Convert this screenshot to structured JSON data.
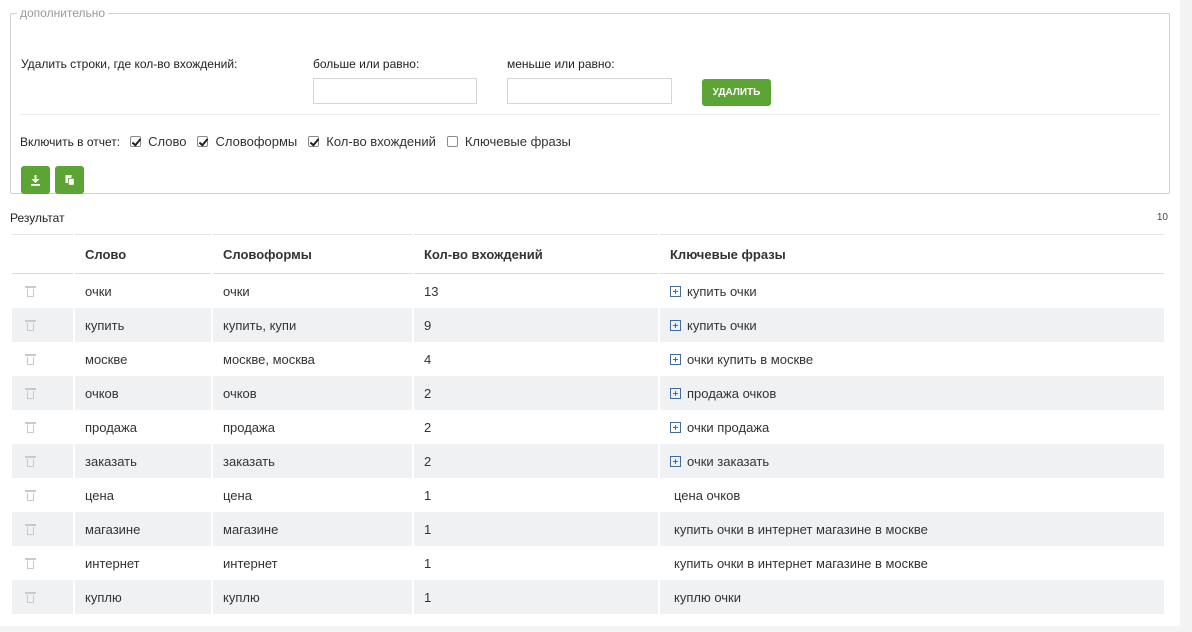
{
  "extra": {
    "legend": "дополнительно",
    "delete_label": "Удалить строки, где кол-во вхождений:",
    "gte_label": "больше или равно:",
    "lte_label": "меньше или равно:",
    "gte_value": "",
    "lte_value": "",
    "delete_button": "УДАЛИТЬ",
    "include_label": "Включить в отчет:",
    "include_options": [
      {
        "label": "Слово",
        "checked": true
      },
      {
        "label": "Словоформы",
        "checked": true
      },
      {
        "label": "Кол-во вхождений",
        "checked": true
      },
      {
        "label": "Ключевые фразы",
        "checked": false
      }
    ],
    "actions": [
      {
        "icon": "download-icon"
      },
      {
        "icon": "copy-icon"
      }
    ]
  },
  "result": {
    "title": "Результат",
    "count": "10",
    "columns": [
      "Слово",
      "Словоформы",
      "Кол-во вхождений",
      "Ключевые фразы"
    ],
    "rows": [
      {
        "word": "очки",
        "forms": "очки",
        "count": "13",
        "phrase": "купить очки",
        "expandable": true
      },
      {
        "word": "купить",
        "forms": "купить, купи",
        "count": "9",
        "phrase": "купить очки",
        "expandable": true
      },
      {
        "word": "москве",
        "forms": "москве, москва",
        "count": "4",
        "phrase": "очки купить в москве",
        "expandable": true
      },
      {
        "word": "очков",
        "forms": "очков",
        "count": "2",
        "phrase": "продажа очков",
        "expandable": true
      },
      {
        "word": "продажа",
        "forms": "продажа",
        "count": "2",
        "phrase": "очки продажа",
        "expandable": true
      },
      {
        "word": "заказать",
        "forms": "заказать",
        "count": "2",
        "phrase": "очки заказать",
        "expandable": true
      },
      {
        "word": "цена",
        "forms": "цена",
        "count": "1",
        "phrase": "цена очков",
        "expandable": false
      },
      {
        "word": "магазине",
        "forms": "магазине",
        "count": "1",
        "phrase": "купить очки в интернет магазине в москве",
        "expandable": false
      },
      {
        "word": "интернет",
        "forms": "интернет",
        "count": "1",
        "phrase": "купить очки в интернет магазине в москве",
        "expandable": false
      },
      {
        "word": "куплю",
        "forms": "куплю",
        "count": "1",
        "phrase": "куплю очки",
        "expandable": false
      }
    ]
  },
  "colors": {
    "accent_green": "#5ca534",
    "row_alt": "#f0f1f3",
    "plus_icon": "#3f6da3"
  }
}
